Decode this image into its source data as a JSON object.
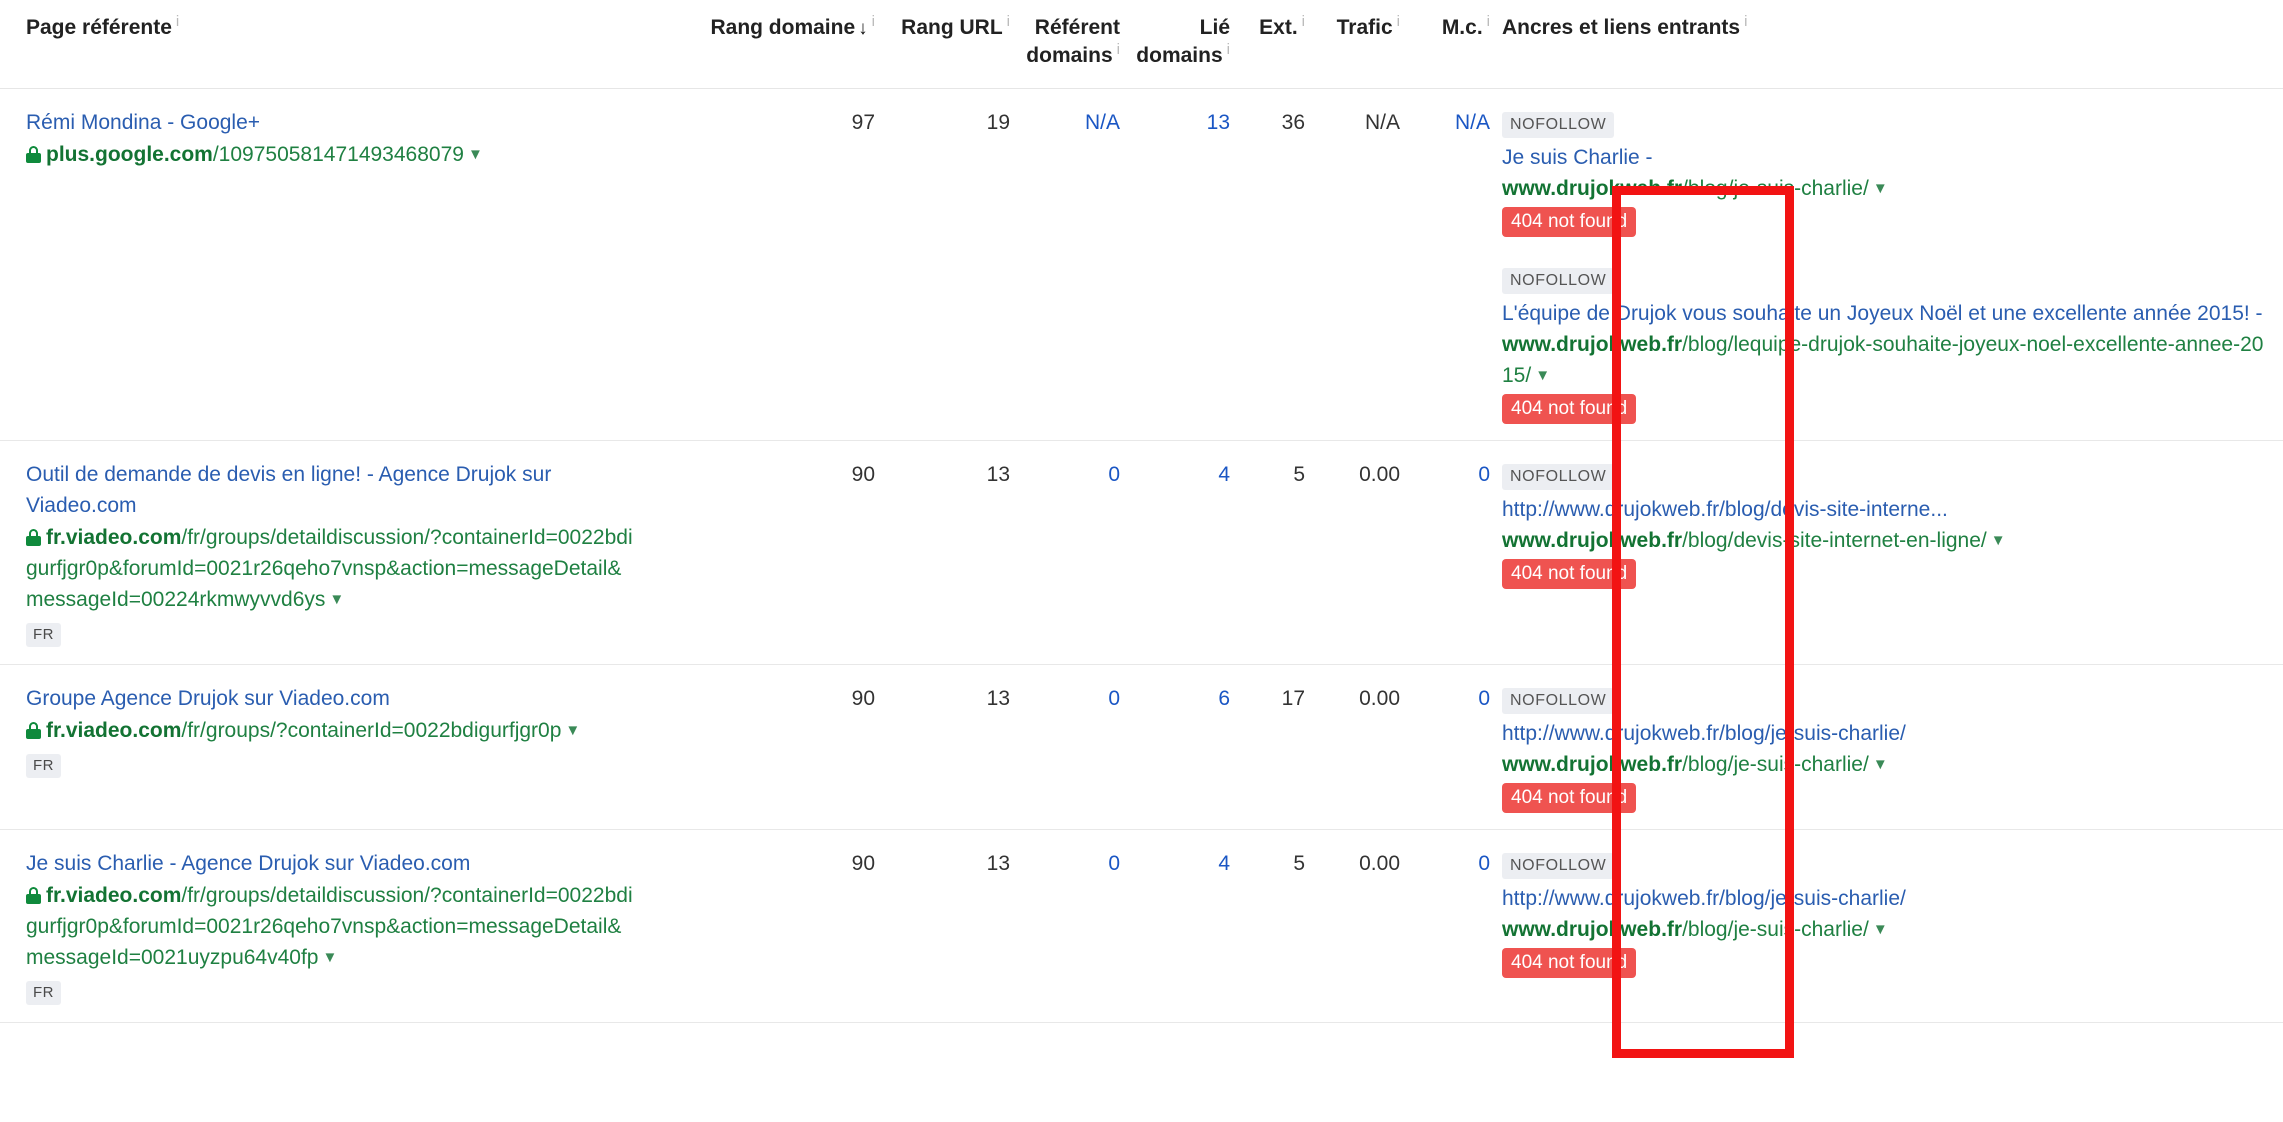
{
  "table": {
    "columns": [
      {
        "id": "page",
        "label": "Page référente",
        "info": "i",
        "sorted": false
      },
      {
        "id": "dr",
        "label": "Rang domaine",
        "info": "i",
        "sorted": true,
        "sort_arrow": "↓"
      },
      {
        "id": "ur",
        "label": "Rang URL",
        "info": "i",
        "sorted": false
      },
      {
        "id": "refdom",
        "label_line1": "Référent",
        "label_line2": "domains",
        "info": "i",
        "sorted": false
      },
      {
        "id": "lied",
        "label_line1": "Lié",
        "label_line2": "domains",
        "info": "i",
        "sorted": false
      },
      {
        "id": "ext",
        "label": "Ext.",
        "info": "i",
        "sorted": false
      },
      {
        "id": "trafic",
        "label": "Trafic",
        "info": "i",
        "sorted": false
      },
      {
        "id": "mc",
        "label": "M.c.",
        "info": "i",
        "sorted": false
      },
      {
        "id": "ancres",
        "label": "Ancres et liens entrants",
        "info": "i",
        "sorted": false
      }
    ],
    "rows": [
      {
        "page_title": "Rémi Mondina - Google+",
        "url_domain": "plus.google.com",
        "url_path": "/109750581471493468079",
        "has_lock": true,
        "lang_badge": "",
        "rang_domaine": "97",
        "rang_url": "19",
        "referent_domains": "N/A",
        "referent_domains_link": true,
        "lie_domains": "13",
        "lie_domains_link": true,
        "ext": "36",
        "trafic": "N/A",
        "trafic_link": false,
        "mc": "N/A",
        "mc_link": true,
        "anchors": [
          {
            "nofollow": "NOFOLLOW",
            "anchor_text": "Je suis Charlie -",
            "target_domain": "www.drujokweb.fr",
            "target_path": "/blog/je-suis-charlie/",
            "status": "404 not found"
          },
          {
            "nofollow": "NOFOLLOW",
            "anchor_text": "L'équipe de Drujok vous souhaite un Joyeux Noël et une excellente année 2015! -",
            "target_domain": "www.drujokweb.fr",
            "target_path": "/blog/lequipe-drujok-souhaite-joyeux-noel-excellente-annee-2015/",
            "status": "404 not found"
          }
        ]
      },
      {
        "page_title": "Outil de demande de devis en ligne! - Agence Drujok sur Viadeo.com",
        "url_domain": "fr.viadeo.com",
        "url_path": "/fr/groups/detaildiscussion/?containerId=0022bdigurfjgr0p&forumId=0021r26qeho7vnsp&action=messageDetail&messageId=00224rkmwyvvd6ys",
        "has_lock": true,
        "lang_badge": "FR",
        "rang_domaine": "90",
        "rang_url": "13",
        "referent_domains": "0",
        "referent_domains_link": true,
        "lie_domains": "4",
        "lie_domains_link": true,
        "ext": "5",
        "trafic": "0.00",
        "trafic_link": false,
        "mc": "0",
        "mc_link": true,
        "anchors": [
          {
            "nofollow": "NOFOLLOW",
            "anchor_text": "http://www.drujokweb.fr/blog/devis-site-interne...",
            "target_domain": "www.drujokweb.fr",
            "target_path": "/blog/devis-site-internet-en-ligne/",
            "status": "404 not found"
          }
        ]
      },
      {
        "page_title": "Groupe Agence Drujok sur Viadeo.com",
        "url_domain": "fr.viadeo.com",
        "url_path": "/fr/groups/?containerId=0022bdigurfjgr0p",
        "has_lock": true,
        "lang_badge": "FR",
        "rang_domaine": "90",
        "rang_url": "13",
        "referent_domains": "0",
        "referent_domains_link": true,
        "lie_domains": "6",
        "lie_domains_link": true,
        "ext": "17",
        "trafic": "0.00",
        "trafic_link": false,
        "mc": "0",
        "mc_link": true,
        "anchors": [
          {
            "nofollow": "NOFOLLOW",
            "anchor_text": "http://www.drujokweb.fr/blog/je-suis-charlie/",
            "target_domain": "www.drujokweb.fr",
            "target_path": "/blog/je-suis-charlie/",
            "status": "404 not found"
          }
        ]
      },
      {
        "page_title": "Je suis Charlie - Agence Drujok sur Viadeo.com",
        "url_domain": "fr.viadeo.com",
        "url_path": "/fr/groups/detaildiscussion/?containerId=0022bdigurfjgr0p&forumId=0021r26qeho7vnsp&action=messageDetail&messageId=0021uyzpu64v40fp",
        "has_lock": true,
        "lang_badge": "FR",
        "rang_domaine": "90",
        "rang_url": "13",
        "referent_domains": "0",
        "referent_domains_link": true,
        "lie_domains": "4",
        "lie_domains_link": true,
        "ext": "5",
        "trafic": "0.00",
        "trafic_link": false,
        "mc": "0",
        "mc_link": true,
        "anchors": [
          {
            "nofollow": "NOFOLLOW",
            "anchor_text": "http://www.drujokweb.fr/blog/je-suis-charlie/",
            "target_domain": "www.drujokweb.fr",
            "target_path": "/blog/je-suis-charlie/",
            "status": "404 not found"
          }
        ]
      }
    ]
  },
  "annotation": {
    "type": "red-rectangle-highlight",
    "color": "#f21313"
  },
  "colors": {
    "link_blue": "#2a5db0",
    "number_link_blue": "#1a56c4",
    "url_green": "#137333",
    "badge_grey_bg": "#eceef2",
    "status_red_bg": "#ef5350",
    "annotation_red": "#f21313"
  }
}
